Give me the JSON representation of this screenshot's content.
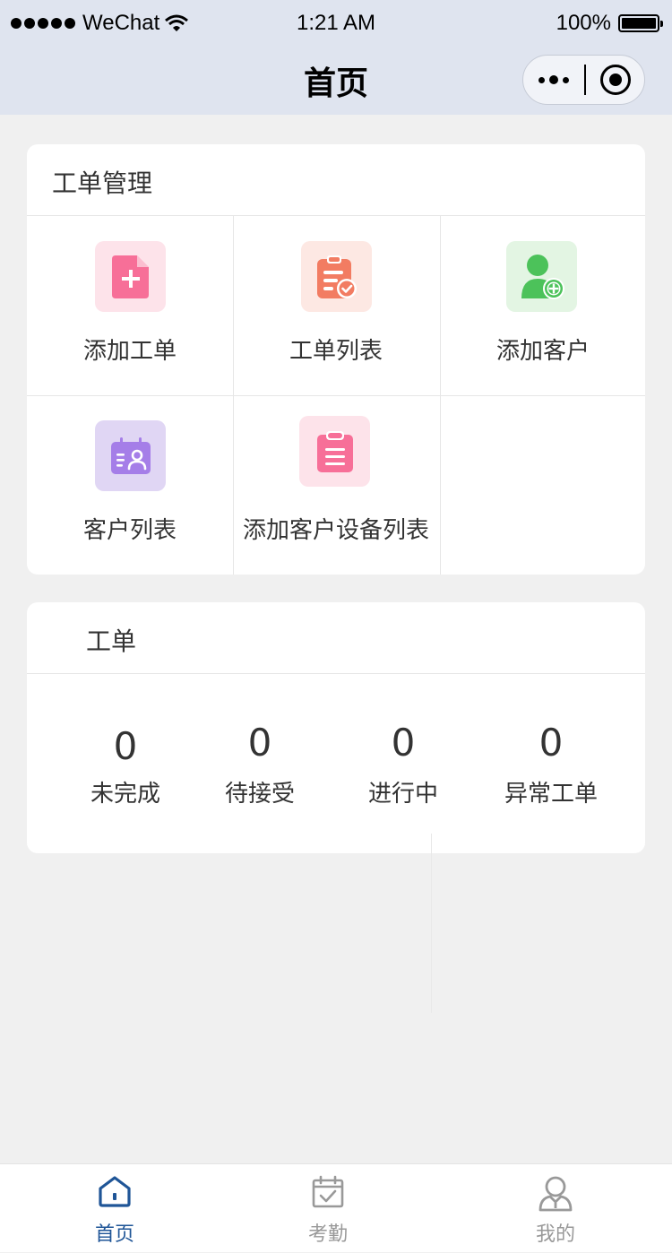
{
  "status_bar": {
    "carrier": "WeChat",
    "time": "1:21 AM",
    "battery": "100%"
  },
  "nav": {
    "title": "首页"
  },
  "work_order_mgmt": {
    "title": "工单管理",
    "items": [
      {
        "label": "添加工单",
        "icon": "add-document-icon",
        "bg": "#fde3ea",
        "fg": "#f76f98"
      },
      {
        "label": "工单列表",
        "icon": "clipboard-check-icon",
        "bg": "#fde8e3",
        "fg": "#f27c62"
      },
      {
        "label": "添加客户",
        "icon": "add-user-icon",
        "bg": "#e3f5e3",
        "fg": "#4cc25a"
      },
      {
        "label": "客户列表",
        "icon": "contact-card-icon",
        "bg": "#e0d6f4",
        "fg": "#a57ee8"
      },
      {
        "label": "添加客户设备列表",
        "icon": "clipboard-list-icon",
        "bg": "#fde3ea",
        "fg": "#f76f98"
      }
    ]
  },
  "work_orders": {
    "title": "工单",
    "stats": [
      {
        "value": "0",
        "label": "未完成"
      },
      {
        "value": "0",
        "label": "待接受"
      },
      {
        "value": "0",
        "label": "进行中"
      },
      {
        "value": "0",
        "label": "异常工单"
      }
    ]
  },
  "tabbar": {
    "active_color": "#1f5597",
    "inactive_color": "#999999",
    "tabs": [
      {
        "label": "首页",
        "icon": "home-icon",
        "active": true
      },
      {
        "label": "考勤",
        "icon": "calendar-check-icon",
        "active": false
      },
      {
        "label": "我的",
        "icon": "user-icon",
        "active": false
      }
    ]
  }
}
